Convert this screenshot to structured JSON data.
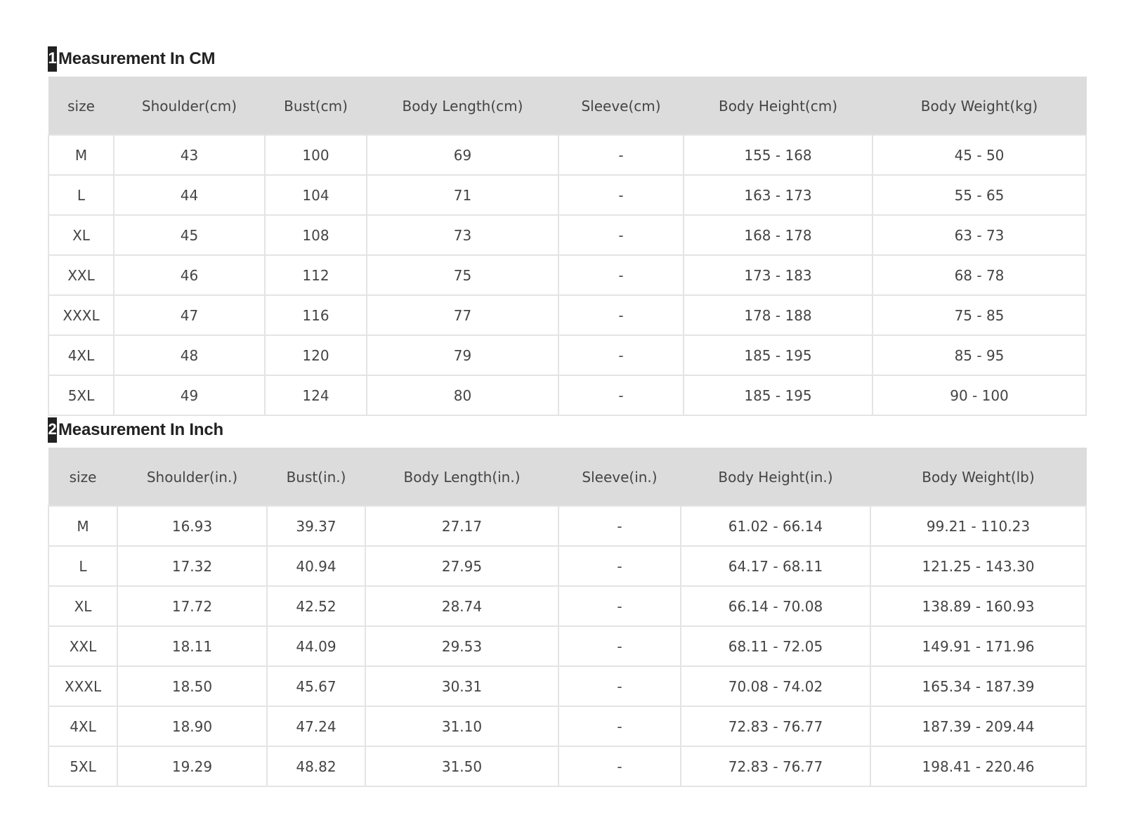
{
  "table_cm": {
    "title_number": "1",
    "title": "Measurement In CM",
    "headers": [
      "size",
      "Shoulder(cm)",
      "Bust(cm)",
      "Body Length(cm)",
      "Sleeve(cm)",
      "Body Height(cm)",
      "Body Weight(kg)"
    ],
    "rows": [
      [
        "M",
        "43",
        "100",
        "69",
        "-",
        "155 - 168",
        "45 - 50"
      ],
      [
        "L",
        "44",
        "104",
        "71",
        "-",
        "163 - 173",
        "55 - 65"
      ],
      [
        "XL",
        "45",
        "108",
        "73",
        "-",
        "168 - 178",
        "63 - 73"
      ],
      [
        "XXL",
        "46",
        "112",
        "75",
        "-",
        "173 - 183",
        "68 - 78"
      ],
      [
        "XXXL",
        "47",
        "116",
        "77",
        "-",
        "178 - 188",
        "75 - 85"
      ],
      [
        "4XL",
        "48",
        "120",
        "79",
        "-",
        "185 - 195",
        "85 - 95"
      ],
      [
        "5XL",
        "49",
        "124",
        "80",
        "-",
        "185 - 195",
        "90 - 100"
      ]
    ]
  },
  "table_inch": {
    "title_number": "2",
    "title": "Measurement In Inch",
    "headers": [
      "size",
      "Shoulder(in.)",
      "Bust(in.)",
      "Body Length(in.)",
      "Sleeve(in.)",
      "Body Height(in.)",
      "Body Weight(lb)"
    ],
    "rows": [
      [
        "M",
        "16.93",
        "39.37",
        "27.17",
        "-",
        "61.02 - 66.14",
        "99.21 - 110.23"
      ],
      [
        "L",
        "17.32",
        "40.94",
        "27.95",
        "-",
        "64.17 - 68.11",
        "121.25 - 143.30"
      ],
      [
        "XL",
        "17.72",
        "42.52",
        "28.74",
        "-",
        "66.14 - 70.08",
        "138.89 - 160.93"
      ],
      [
        "XXL",
        "18.11",
        "44.09",
        "29.53",
        "-",
        "68.11 - 72.05",
        "149.91 - 171.96"
      ],
      [
        "XXXL",
        "18.50",
        "45.67",
        "30.31",
        "-",
        "70.08 - 74.02",
        "165.34 - 187.39"
      ],
      [
        "4XL",
        "18.90",
        "47.24",
        "31.10",
        "-",
        "72.83 - 76.77",
        "187.39 - 209.44"
      ],
      [
        "5XL",
        "19.29",
        "48.82",
        "31.50",
        "-",
        "72.83 - 76.77",
        "198.41 - 220.46"
      ]
    ]
  },
  "colors": {
    "header_bg": "#dcdcdc",
    "border": "#e4e4e4",
    "text": "#444444",
    "badge": "#222222"
  }
}
